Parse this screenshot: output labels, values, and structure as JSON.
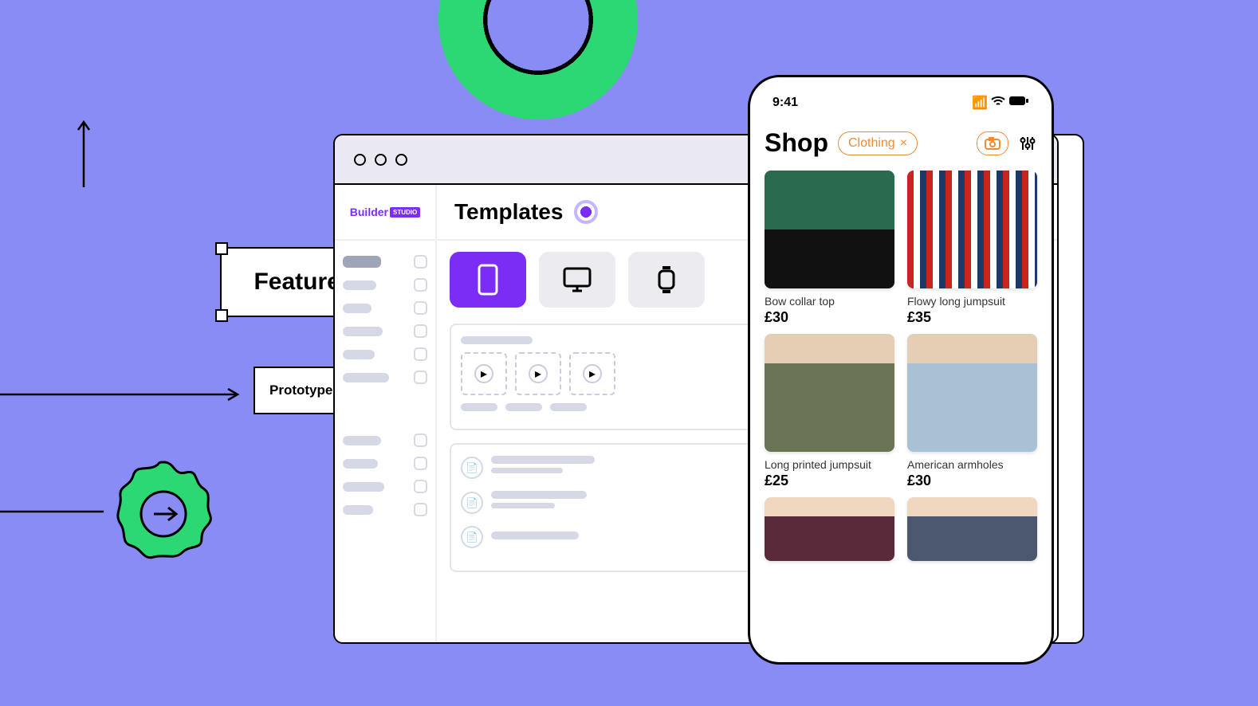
{
  "features_label": "Features",
  "prototype_label": "Prototype",
  "builder": {
    "brand": "Builder",
    "brand_badge": "STUDIO",
    "title": "Templates"
  },
  "phone": {
    "time": "9:41",
    "title": "Shop",
    "chip_label": "Clothing",
    "chip_close": "×",
    "products": [
      {
        "name": "Bow collar top",
        "price": "£30"
      },
      {
        "name": "Flowy long jumpsuit",
        "price": "£35"
      },
      {
        "name": "Long printed jumpsuit",
        "price": "£25"
      },
      {
        "name": "American armholes",
        "price": "£30"
      },
      {
        "name": "",
        "price": ""
      },
      {
        "name": "",
        "price": ""
      }
    ]
  }
}
